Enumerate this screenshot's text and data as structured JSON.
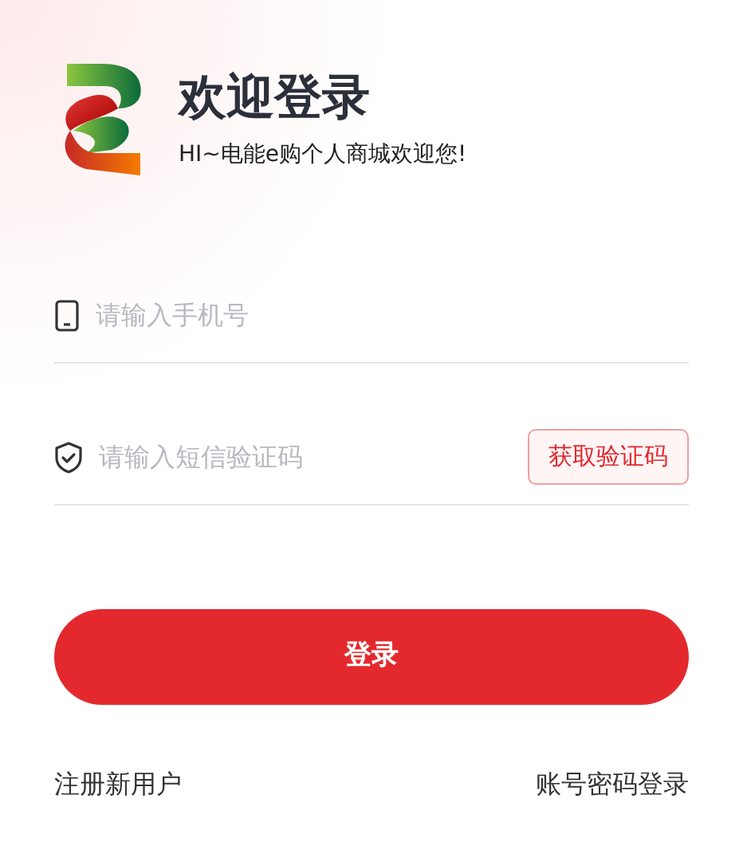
{
  "header": {
    "title": "欢迎登录",
    "subtitle": "HI~电能e购个人商城欢迎您!"
  },
  "fields": [
    {
      "kind": "phone",
      "placeholder": "请输入手机号"
    },
    {
      "kind": "code",
      "placeholder": "请输入短信验证码",
      "action": "获取验证码"
    }
  ],
  "login_button": "登录",
  "links": [
    "注册新用户",
    "账号密码登录"
  ]
}
